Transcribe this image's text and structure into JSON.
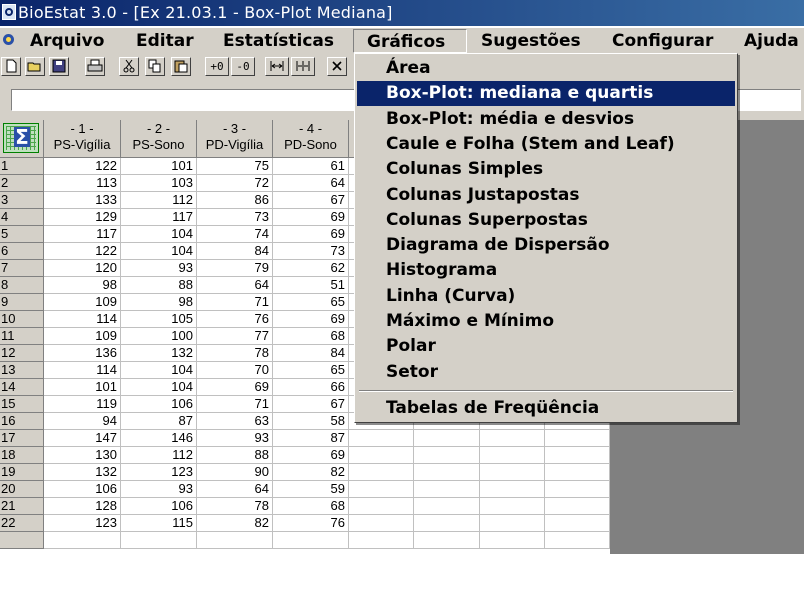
{
  "window": {
    "title": "BioEstat 3.0 - [Ex 21.03.1 - Box-Plot Mediana]"
  },
  "menubar": {
    "items": [
      {
        "label": "Arquivo"
      },
      {
        "label": "Editar"
      },
      {
        "label": "Estatísticas"
      },
      {
        "label": "Gráficos"
      },
      {
        "label": "Sugestões"
      },
      {
        "label": "Configurar"
      },
      {
        "label": "Ajuda"
      }
    ],
    "open_menu": "Gráficos"
  },
  "toolbar": {
    "buttons": [
      {
        "icon": "new-file-icon"
      },
      {
        "icon": "open-folder-icon"
      },
      {
        "icon": "save-disk-icon"
      },
      {
        "icon": "print-icon"
      },
      {
        "icon": "cut-icon"
      },
      {
        "icon": "copy-icon"
      },
      {
        "icon": "paste-icon"
      },
      {
        "icon": "increase-decimal-icon",
        "label": "+0"
      },
      {
        "icon": "decrease-decimal-icon",
        "label": "-0"
      },
      {
        "icon": "column-width-icon"
      },
      {
        "icon": "column-split-icon"
      },
      {
        "icon": "clear-x-icon"
      }
    ]
  },
  "formula_bar": {
    "value": ""
  },
  "sheet": {
    "columns": [
      {
        "number": "- 1 -",
        "label": "PS-Vigília"
      },
      {
        "number": "- 2 -",
        "label": "PS-Sono"
      },
      {
        "number": "- 3 -",
        "label": "PD-Vigília"
      },
      {
        "number": "- 4 -",
        "label": "PD-Sono"
      }
    ],
    "rows": [
      {
        "n": "1",
        "v": [
          "122",
          "101",
          "75",
          "61"
        ]
      },
      {
        "n": "2",
        "v": [
          "113",
          "103",
          "72",
          "64"
        ]
      },
      {
        "n": "3",
        "v": [
          "133",
          "112",
          "86",
          "67"
        ]
      },
      {
        "n": "4",
        "v": [
          "129",
          "117",
          "73",
          "69"
        ]
      },
      {
        "n": "5",
        "v": [
          "117",
          "104",
          "74",
          "69"
        ]
      },
      {
        "n": "6",
        "v": [
          "122",
          "104",
          "84",
          "73"
        ]
      },
      {
        "n": "7",
        "v": [
          "120",
          "93",
          "79",
          "62"
        ]
      },
      {
        "n": "8",
        "v": [
          "98",
          "88",
          "64",
          "51"
        ]
      },
      {
        "n": "9",
        "v": [
          "109",
          "98",
          "71",
          "65"
        ]
      },
      {
        "n": "10",
        "v": [
          "114",
          "105",
          "76",
          "69"
        ]
      },
      {
        "n": "11",
        "v": [
          "109",
          "100",
          "77",
          "68"
        ]
      },
      {
        "n": "12",
        "v": [
          "136",
          "132",
          "78",
          "84"
        ]
      },
      {
        "n": "13",
        "v": [
          "114",
          "104",
          "70",
          "65"
        ]
      },
      {
        "n": "14",
        "v": [
          "101",
          "104",
          "69",
          "66"
        ]
      },
      {
        "n": "15",
        "v": [
          "119",
          "106",
          "71",
          "67"
        ]
      },
      {
        "n": "16",
        "v": [
          "94",
          "87",
          "63",
          "58"
        ]
      },
      {
        "n": "17",
        "v": [
          "147",
          "146",
          "93",
          "87"
        ]
      },
      {
        "n": "18",
        "v": [
          "130",
          "112",
          "88",
          "69"
        ]
      },
      {
        "n": "19",
        "v": [
          "132",
          "123",
          "90",
          "82"
        ]
      },
      {
        "n": "20",
        "v": [
          "106",
          "93",
          "64",
          "59"
        ]
      },
      {
        "n": "21",
        "v": [
          "128",
          "106",
          "78",
          "68"
        ]
      },
      {
        "n": "22",
        "v": [
          "123",
          "115",
          "82",
          "76"
        ]
      }
    ]
  },
  "graficos_menu": {
    "items": [
      {
        "label": "Área"
      },
      {
        "label": "Box-Plot: mediana e quartis",
        "selected": true
      },
      {
        "label": "Box-Plot: média e desvios"
      },
      {
        "label": "Caule e Folha (Stem and Leaf)"
      },
      {
        "label": "Colunas Simples"
      },
      {
        "label": "Colunas Justapostas"
      },
      {
        "label": "Colunas Superpostas"
      },
      {
        "label": "Diagrama de Dispersão"
      },
      {
        "label": "Histograma"
      },
      {
        "label": "Linha (Curva)"
      },
      {
        "label": "Máximo e Mínimo"
      },
      {
        "label": "Polar"
      },
      {
        "label": "Setor"
      }
    ],
    "footer_item": {
      "label": "Tabelas de Freqüência"
    }
  }
}
